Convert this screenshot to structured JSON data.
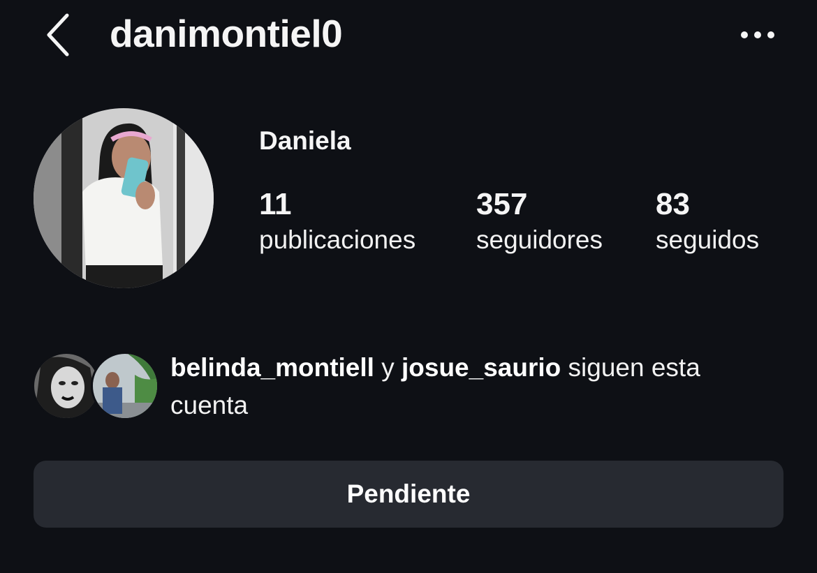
{
  "header": {
    "username": "danimontiel0",
    "back_icon": "chevron-left-icon",
    "more_icon": "more-horizontal-icon"
  },
  "profile": {
    "display_name": "Daniela",
    "avatar": "profile-photo"
  },
  "stats": [
    {
      "value": "11",
      "label": "publicaciones"
    },
    {
      "value": "357",
      "label": "seguidores"
    },
    {
      "value": "83",
      "label": "seguidos"
    }
  ],
  "mutual_followers": {
    "user1": "belinda_montiell",
    "connector": "y",
    "user2": "josue_saurio",
    "suffix_line1": "siguen esta",
    "suffix_line2": "cuenta"
  },
  "actions": {
    "follow_status_label": "Pendiente"
  },
  "colors": {
    "background": "#0e1015",
    "button": "#272a31",
    "text": "#f5f5f5"
  }
}
